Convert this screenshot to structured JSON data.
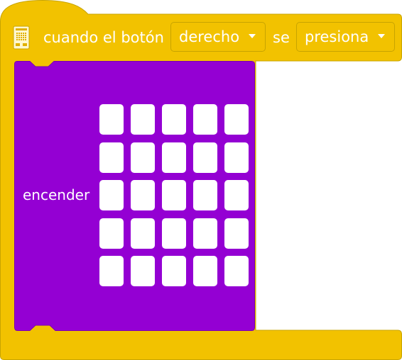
{
  "event_block": {
    "icon": "microbit-board-icon",
    "label_when": "cuando el botón",
    "button_dropdown": {
      "selected": "derecho"
    },
    "label_se": "se",
    "action_dropdown": {
      "selected": "presiona"
    },
    "color": "#f2c200",
    "border_color": "#c8a400"
  },
  "inner_block": {
    "label": "encender",
    "color": "#9400d3",
    "border_color": "#7a00b0"
  },
  "led_matrix": {
    "rows": [
      [
        false,
        false,
        false,
        false,
        false
      ],
      [
        false,
        false,
        false,
        false,
        false
      ],
      [
        false,
        false,
        false,
        false,
        false
      ],
      [
        false,
        false,
        false,
        false,
        false
      ],
      [
        false,
        false,
        false,
        false,
        false
      ]
    ]
  }
}
